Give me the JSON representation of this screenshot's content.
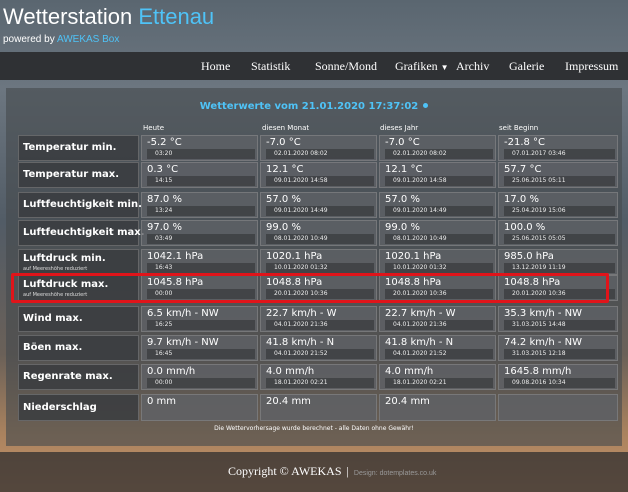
{
  "header": {
    "title_main": "Wetterstation ",
    "title_accent": "Ettenau",
    "powered_prefix": "powered by ",
    "powered_link": "AWEKAS Box"
  },
  "nav": {
    "home": "Home",
    "statistik": "Statistik",
    "sonne_mond": "Sonne/Mond",
    "grafiken": "Grafiken",
    "archiv": "Archiv",
    "galerie": "Galerie",
    "impressum": "Impressum"
  },
  "content": {
    "title": "Wetterwerte vom 21.01.2020 17:37:02"
  },
  "columns": [
    "Heute",
    "diesen Monat",
    "dieses Jahr",
    "seit Beginn"
  ],
  "rows": [
    {
      "label": "Temperatur min.",
      "sub": "",
      "cells": [
        {
          "v": "-5.2 °C",
          "t": "03:20"
        },
        {
          "v": "-7.0 °C",
          "t": "02.01.2020 08:02"
        },
        {
          "v": "-7.0 °C",
          "t": "02.01.2020 08:02"
        },
        {
          "v": "-21.8 °C",
          "t": "07.01.2017 03:46"
        }
      ]
    },
    {
      "label": "Temperatur max.",
      "sub": "",
      "cells": [
        {
          "v": "0.3 °C",
          "t": "14:15"
        },
        {
          "v": "12.1 °C",
          "t": "09.01.2020 14:58"
        },
        {
          "v": "12.1 °C",
          "t": "09.01.2020 14:58"
        },
        {
          "v": "57.7 °C",
          "t": "25.06.2015 05:11"
        }
      ]
    },
    {
      "label": "Luftfeuchtigkeit min.",
      "sub": "",
      "cells": [
        {
          "v": "87.0 %",
          "t": "13:24"
        },
        {
          "v": "57.0 %",
          "t": "09.01.2020 14:49"
        },
        {
          "v": "57.0 %",
          "t": "09.01.2020 14:49"
        },
        {
          "v": "17.0 %",
          "t": "25.04.2019 15:06"
        }
      ]
    },
    {
      "label": "Luftfeuchtigkeit max.",
      "sub": "",
      "cells": [
        {
          "v": "97.0 %",
          "t": "03:49"
        },
        {
          "v": "99.0 %",
          "t": "08.01.2020 10:49"
        },
        {
          "v": "99.0 %",
          "t": "08.01.2020 10:49"
        },
        {
          "v": "100.0 %",
          "t": "25.06.2015 05:05"
        }
      ]
    },
    {
      "label": "Luftdruck min.",
      "sub": "auf Meereshöhe reduziert",
      "cells": [
        {
          "v": "1042.1 hPa",
          "t": "16:43"
        },
        {
          "v": "1020.1 hPa",
          "t": "10.01.2020 01:32"
        },
        {
          "v": "1020.1 hPa",
          "t": "10.01.2020 01:32"
        },
        {
          "v": "985.0 hPa",
          "t": "13.12.2019 11:19"
        }
      ]
    },
    {
      "label": "Luftdruck max.",
      "sub": "auf Meereshöhe reduziert",
      "cells": [
        {
          "v": "1045.8 hPa",
          "t": "00:00"
        },
        {
          "v": "1048.8 hPa",
          "t": "20.01.2020 10:36"
        },
        {
          "v": "1048.8 hPa",
          "t": "20.01.2020 10:36"
        },
        {
          "v": "1048.8 hPa",
          "t": "20.01.2020 10:36"
        }
      ]
    },
    {
      "label": "Wind max.",
      "sub": "",
      "cells": [
        {
          "v": "6.5 km/h - NW",
          "t": "16:25"
        },
        {
          "v": "22.7 km/h - W",
          "t": "04.01.2020 21:36"
        },
        {
          "v": "22.7 km/h - W",
          "t": "04.01.2020 21:36"
        },
        {
          "v": "35.3 km/h - NW",
          "t": "31.03.2015 14:48"
        }
      ]
    },
    {
      "label": "Böen max.",
      "sub": "",
      "cells": [
        {
          "v": "9.7 km/h - NW",
          "t": "16:45"
        },
        {
          "v": "41.8 km/h - N",
          "t": "04.01.2020 21:52"
        },
        {
          "v": "41.8 km/h - N",
          "t": "04.01.2020 21:52"
        },
        {
          "v": "74.2 km/h - NW",
          "t": "31.03.2015 12:18"
        }
      ]
    },
    {
      "label": "Regenrate max.",
      "sub": "",
      "cells": [
        {
          "v": "0.0 mm/h",
          "t": "00:00"
        },
        {
          "v": "4.0 mm/h",
          "t": "18.01.2020 02:21"
        },
        {
          "v": "4.0 mm/h",
          "t": "18.01.2020 02:21"
        },
        {
          "v": "1645.8 mm/h",
          "t": "09.08.2016 10:34"
        }
      ]
    },
    {
      "label": "Niederschlag",
      "sub": "",
      "cells": [
        {
          "v": "0 mm",
          "t": ""
        },
        {
          "v": "20.4 mm",
          "t": ""
        },
        {
          "v": "20.4 mm",
          "t": ""
        },
        {
          "v": "",
          "t": ""
        }
      ]
    }
  ],
  "disclaimer": "Die Wettervorhersage wurde berechnet - alle Daten ohne Gewähr!",
  "footer": {
    "copyright": "Copyright © AWEKAS",
    "separator": "|",
    "credit": "Design: dotemplates.co.uk"
  },
  "colors": {
    "accent": "#4fc3f7",
    "highlight": "#e0141a",
    "nav_bg": "#2f3134"
  }
}
